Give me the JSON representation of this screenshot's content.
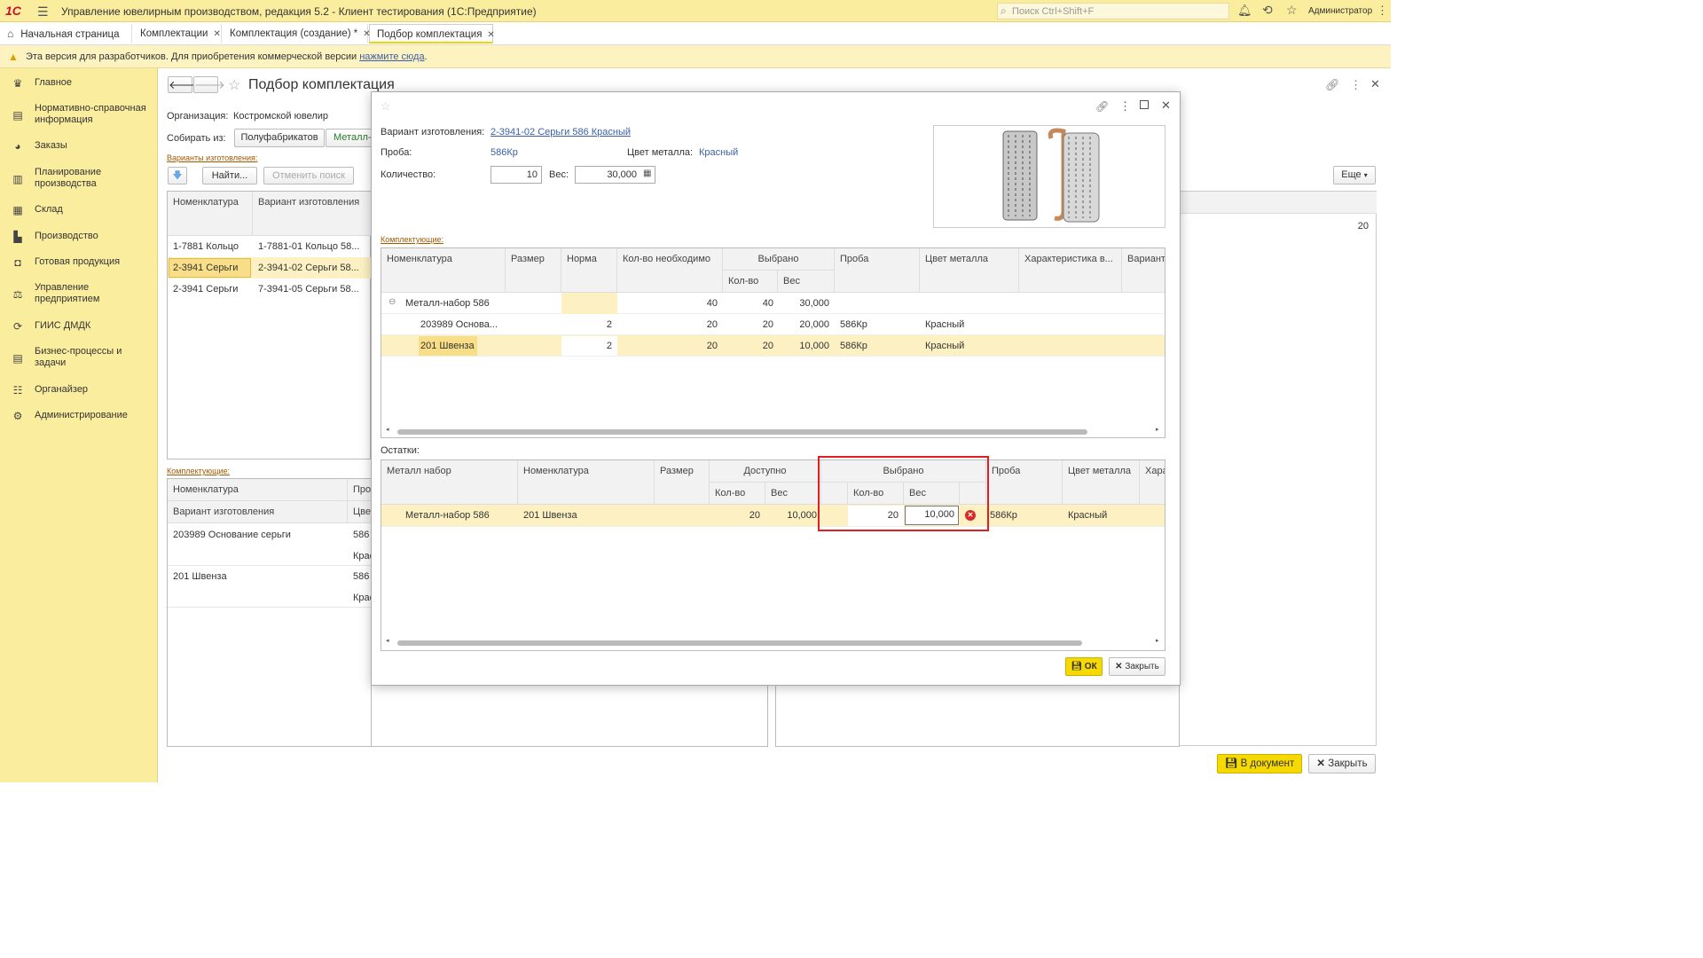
{
  "app": {
    "logo": "1С",
    "title": "Управление ювелирным производством, редакция 5.2  - Клиент тестирования (1С:Предприятие)",
    "search_placeholder": "Поиск Ctrl+Shift+F",
    "user": "Администратор"
  },
  "tabs": [
    {
      "label": "Начальная страница"
    },
    {
      "label": "Комплектации"
    },
    {
      "label": "Комплектация (создание) *"
    },
    {
      "label": "Подбор комплектация"
    }
  ],
  "warning": {
    "text": "Эта версия для разработчиков. Для приобретения коммерческой версии ",
    "link": "нажмите сюда",
    "suffix": "."
  },
  "sidebar": [
    {
      "label": "Главное",
      "icon": "menu-icon"
    },
    {
      "label": "Нормативно-справочная информация",
      "icon": "book-icon"
    },
    {
      "label": "Заказы",
      "icon": "pie-icon"
    },
    {
      "label": "Планирование производства",
      "icon": "doc-icon"
    },
    {
      "label": "Склад",
      "icon": "grid-icon"
    },
    {
      "label": "Производство",
      "icon": "factory-icon"
    },
    {
      "label": "Готовая продукция",
      "icon": "bag-icon"
    },
    {
      "label": "Управление предприятием",
      "icon": "org-icon"
    },
    {
      "label": "ГИИС ДМДК",
      "icon": "sync-icon"
    },
    {
      "label": "Бизнес-процессы и задачи",
      "icon": "tasks-icon"
    },
    {
      "label": "Органайзер",
      "icon": "list-icon"
    },
    {
      "label": "Администрирование",
      "icon": "gear-icon"
    }
  ],
  "main": {
    "title": "Подбор комплектация",
    "org_label": "Организация:",
    "org_value": "Костромской ювелир",
    "collect_label": "Собирать из:",
    "collect_opt1": "Полуфабрикатов",
    "collect_opt2": "Металл-",
    "variants_link": "Варианты изготовления:",
    "find_btn": "Найти...",
    "cancel_search_btn": "Отменить поиск",
    "col_nom": "Номенклатура",
    "col_var": "Вариант изготовления",
    "rows": [
      {
        "nom": "1-7881 Кольцо",
        "var": "1-7881-01 Кольцо 58..."
      },
      {
        "nom": "2-3941 Серьги",
        "var": "2-3941-02 Серьги 58..."
      },
      {
        "nom": "2-3941 Серьги",
        "var": "7-3941-05 Серьги 58..."
      }
    ],
    "more_btn": "Еще",
    "right_value": "20",
    "comp_link": "Комплектующие:",
    "comp_h1": "Номенклатура",
    "comp_h2": "Вариант изготовления",
    "comp_h3": "Про",
    "comp_h4": "Цвет",
    "comp_rows": [
      {
        "a": "203989 Основание серьги",
        "b": "586",
        "c": "Крас"
      },
      {
        "a": "201 Швенза",
        "b": "586",
        "c": "Крас"
      }
    ],
    "to_doc_btn": "В документ",
    "close_btn": "Закрыть"
  },
  "dialog": {
    "variant_label": "Вариант изготовления:",
    "variant_value": "2-3941-02 Серьги 586 Красный",
    "proba_label": "Проба:",
    "proba_value": "586Кр",
    "color_label": "Цвет металла:",
    "color_value": "Красный",
    "qty_label": "Количество:",
    "qty_value": "10",
    "weight_label": "Вес:",
    "weight_value": "30,000",
    "comp_link": "Комплектующие:",
    "t1": {
      "h_nom": "Номенклатура",
      "h_size": "Размер",
      "h_norm": "Норма",
      "h_need": "Кол-во  необходимо",
      "h_sel": "Выбрано",
      "h_qty": "Кол-во",
      "h_w": "Вес",
      "h_proba": "Проба",
      "h_color": "Цвет металла",
      "h_char": "Характеристика в...",
      "h_var": "Вариант",
      "rows": [
        {
          "nom": "Металл-набор 586",
          "size": "",
          "norm": "",
          "need": "40",
          "qty": "40",
          "w": "30,000",
          "proba": "",
          "color": ""
        },
        {
          "nom": "203989 Основа...",
          "size": "",
          "norm": "2",
          "need": "20",
          "qty": "20",
          "w": "20,000",
          "proba": "586Кр",
          "color": "Красный"
        },
        {
          "nom": "201 Швенза",
          "size": "",
          "norm": "2",
          "need": "20",
          "qty": "20",
          "w": "10,000",
          "proba": "586Кр",
          "color": "Красный"
        }
      ]
    },
    "rest_label": "Остатки:",
    "t2": {
      "h_set": "Металл набор",
      "h_nom": "Номенклатура",
      "h_size": "Размер",
      "h_avail": "Доступно",
      "h_qty": "Кол-во",
      "h_w": "Вес",
      "h_sel": "Выбрано",
      "h_sqty": "Кол-во",
      "h_sw": "Вес",
      "h_proba": "Проба",
      "h_color": "Цвет металла",
      "h_char": "Хара",
      "row": {
        "set": "Металл-набор 586",
        "nom": "201 Швенза",
        "size": "",
        "qty": "20",
        "w": "10,000",
        "sqty": "20",
        "sw": "10,000",
        "proba": "586Кр",
        "color": "Красный"
      }
    },
    "ok_btn": "ОК",
    "close_btn": "Закрыть"
  },
  "colors": {
    "accent": "#f5d900",
    "highlight": "#e02020",
    "link": "#3a5fa8"
  }
}
